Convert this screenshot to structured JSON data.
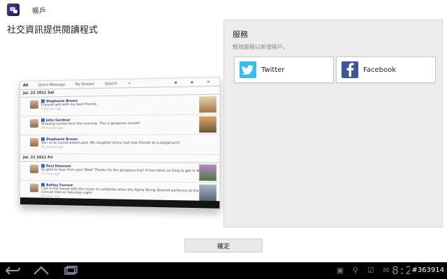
{
  "window": {
    "title": "帳戶"
  },
  "page": {
    "heading": "社交資訊提供閱讀程式"
  },
  "preview": {
    "tabs": [
      "All",
      "Direct Message",
      "My Stream",
      "Search",
      "+"
    ],
    "date_row_1": "Jul. 23  2011  Sat",
    "date_row_2": "Jul. 22  2011  Fri",
    "posts": [
      {
        "name": "Stephanie Brown",
        "text": "Enjoyed grill with my best friends.",
        "time": "5 minutes ago"
      },
      {
        "name": "John Gardner",
        "text": "Amazing sunset here this evening. This is gorgeous sunset!",
        "time": "20 minutes ago"
      },
      {
        "name": "Stephanie Brown",
        "text": "Yes! so at sunset beach park. My daughter Jenny had new friends at a playground",
        "time": "30 minutes ago"
      },
      {
        "name": "Paul Emerson",
        "text": "So glad to hear from you! Wow! Thanks for the gorgeous trip! It has taken so long to get in Nature!",
        "time": "13 hours ago"
      },
      {
        "name": "Ashley Forrest",
        "text": "I am in the house with the music to celebrate when the Alpha String Quartet performs at the White Concert Hall on Saturday night",
        "time": "15 hours ago"
      }
    ]
  },
  "services": {
    "title": "服務",
    "hint": "輕按服務以新增帳戶。",
    "items": [
      {
        "label": "Twitter",
        "icon": "twitter-icon"
      },
      {
        "label": "Facebook",
        "icon": "facebook-icon"
      }
    ]
  },
  "actions": {
    "ok_label": "確定"
  },
  "system_bar": {
    "clock": "8:2",
    "watermark": "#363914"
  },
  "colors": {
    "twitter": "#33c0f0",
    "facebook": "#3b5998",
    "panel": "#ededed",
    "system_bar": "#000000"
  }
}
